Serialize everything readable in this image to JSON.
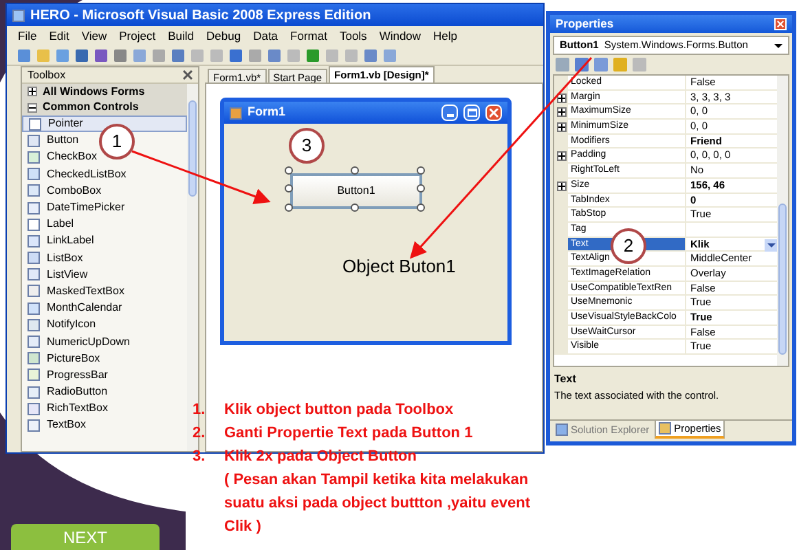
{
  "window": {
    "title": "HERO - Microsoft Visual Basic 2008 Express Edition"
  },
  "menu": [
    "File",
    "Edit",
    "View",
    "Project",
    "Build",
    "Debug",
    "Data",
    "Format",
    "Tools",
    "Window",
    "Help"
  ],
  "toolbox": {
    "title": "Toolbox",
    "groups": [
      {
        "label": "All Windows Forms",
        "expanded": false
      },
      {
        "label": "Common Controls",
        "expanded": true
      }
    ],
    "items": [
      {
        "label": "Pointer",
        "selected": true
      },
      {
        "label": "Button",
        "selected": false
      },
      {
        "label": "CheckBox",
        "selected": false
      },
      {
        "label": "CheckedListBox",
        "selected": false
      },
      {
        "label": "ComboBox",
        "selected": false
      },
      {
        "label": "DateTimePicker",
        "selected": false
      },
      {
        "label": "Label",
        "selected": false
      },
      {
        "label": "LinkLabel",
        "selected": false
      },
      {
        "label": "ListBox",
        "selected": false
      },
      {
        "label": "ListView",
        "selected": false
      },
      {
        "label": "MaskedTextBox",
        "selected": false
      },
      {
        "label": "MonthCalendar",
        "selected": false
      },
      {
        "label": "NotifyIcon",
        "selected": false
      },
      {
        "label": "NumericUpDown",
        "selected": false
      },
      {
        "label": "PictureBox",
        "selected": false
      },
      {
        "label": "ProgressBar",
        "selected": false
      },
      {
        "label": "RadioButton",
        "selected": false
      },
      {
        "label": "RichTextBox",
        "selected": false
      },
      {
        "label": "TextBox",
        "selected": false
      }
    ]
  },
  "tabs": [
    {
      "label": "Form1.vb*",
      "selected": false
    },
    {
      "label": "Start Page",
      "selected": false
    },
    {
      "label": "Form1.vb [Design]*",
      "selected": true
    }
  ],
  "form": {
    "title": "Form1",
    "button": "Button1",
    "caption": "Object Buton1"
  },
  "callouts": [
    "1",
    "2",
    "3"
  ],
  "properties": {
    "title": "Properties",
    "object": "Button1",
    "type": "System.Windows.Forms.Button",
    "rows": [
      {
        "name": "Locked",
        "value": "False",
        "expandable": false,
        "bold": false,
        "selected": false
      },
      {
        "name": "Margin",
        "value": "3, 3, 3, 3",
        "expandable": true,
        "bold": false,
        "selected": false
      },
      {
        "name": "MaximumSize",
        "value": "0, 0",
        "expandable": true,
        "bold": false,
        "selected": false
      },
      {
        "name": "MinimumSize",
        "value": "0, 0",
        "expandable": true,
        "bold": false,
        "selected": false
      },
      {
        "name": "Modifiers",
        "value": "Friend",
        "expandable": false,
        "bold": true,
        "selected": false
      },
      {
        "name": "Padding",
        "value": "0, 0, 0, 0",
        "expandable": true,
        "bold": false,
        "selected": false
      },
      {
        "name": "RightToLeft",
        "value": "No",
        "expandable": false,
        "bold": false,
        "selected": false
      },
      {
        "name": "Size",
        "value": "156, 46",
        "expandable": true,
        "bold": true,
        "selected": false
      },
      {
        "name": "TabIndex",
        "value": "0",
        "expandable": false,
        "bold": true,
        "selected": false
      },
      {
        "name": "TabStop",
        "value": "True",
        "expandable": false,
        "bold": false,
        "selected": false
      },
      {
        "name": "Tag",
        "expandable": false,
        "selected": false
      },
      {
        "name": "Text",
        "value": "Klik",
        "expandable": false,
        "bold": true,
        "selected": true
      },
      {
        "name": "TextAlign",
        "value": "MiddleCenter",
        "expandable": false,
        "bold": false,
        "selected": false
      },
      {
        "name": "TextImageRelation",
        "value": "Overlay",
        "expandable": false,
        "bold": false,
        "selected": false
      },
      {
        "name": "UseCompatibleTextRen",
        "value": "False",
        "expandable": false,
        "bold": false,
        "selected": false
      },
      {
        "name": "UseMnemonic",
        "value": "True",
        "expandable": false,
        "bold": false,
        "selected": false
      },
      {
        "name": "UseVisualStyleBackColo",
        "value": "True",
        "expandable": false,
        "bold": true,
        "selected": false
      },
      {
        "name": "UseWaitCursor",
        "value": "False",
        "expandable": false,
        "bold": false,
        "selected": false
      },
      {
        "name": "Visible",
        "value": "True",
        "expandable": false,
        "bold": false,
        "selected": false
      }
    ],
    "description_title": "Text",
    "description": "The text associated with the control.",
    "tabs": [
      {
        "label": "Solution Explorer",
        "selected": false
      },
      {
        "label": "Properties",
        "selected": true
      }
    ]
  },
  "steps": [
    {
      "number": "1.",
      "text": "Klik object button pada Toolbox"
    },
    {
      "number": "2.",
      "text": "Ganti Propertie Text pada Button 1"
    },
    {
      "number": "3.",
      "text": "Klik 2x pada Object Button",
      "note": "( Pesan akan Tampil ketika kita melakukan suatu aksi pada object buttton ,yaitu event Clik )"
    }
  ],
  "next_button": "NEXT"
}
